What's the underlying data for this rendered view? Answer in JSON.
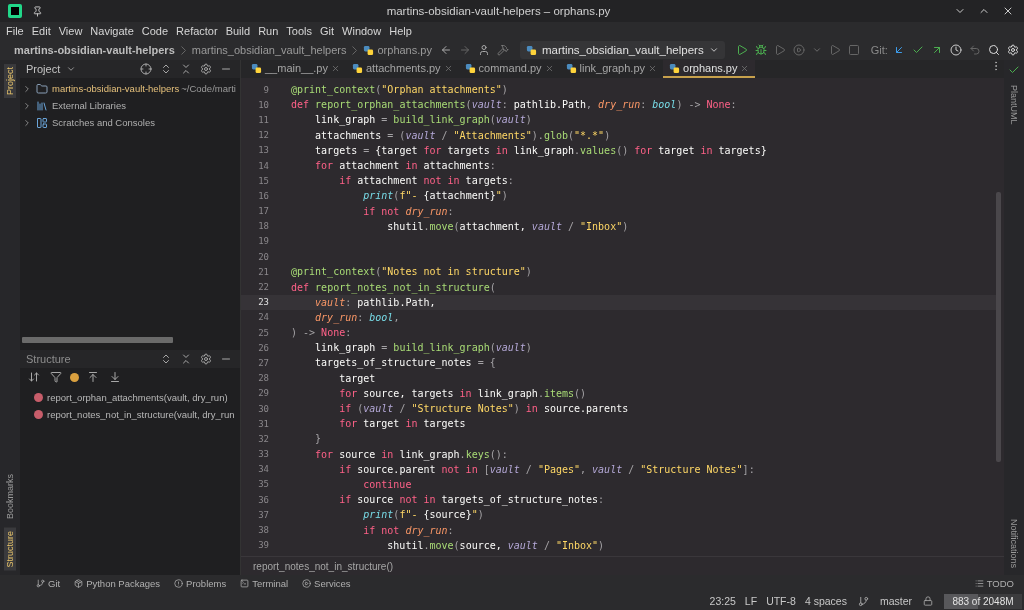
{
  "window": {
    "title": "martins-obsidian-vault-helpers – orphans.py"
  },
  "menu": [
    "File",
    "Edit",
    "View",
    "Navigate",
    "Code",
    "Refactor",
    "Build",
    "Run",
    "Tools",
    "Git",
    "Window",
    "Help"
  ],
  "nav": {
    "breadcrumbs": [
      "martins-obsidian-vault-helpers",
      "martins_obsidian_vault_helpers",
      "orphans.py"
    ],
    "run_config": "martins_obsidian_vault_helpers",
    "git_label": "Git:"
  },
  "left_strip": {
    "top": [
      {
        "label": "Project",
        "selected": true
      }
    ],
    "bottom": [
      {
        "label": "Bookmarks",
        "selected": false
      },
      {
        "label": "Structure",
        "selected": true
      }
    ]
  },
  "project": {
    "title": "Project",
    "items": [
      {
        "kind": "folder",
        "name": "martins-obsidian-vault-helpers",
        "hint": "~/Code/marti",
        "expanded": false
      },
      {
        "kind": "library",
        "name": "External Libraries",
        "expanded": false
      },
      {
        "kind": "scratches",
        "name": "Scratches and Consoles",
        "expanded": false
      }
    ]
  },
  "structure": {
    "title": "Structure",
    "items": [
      "report_orphan_attachments(vault, dry_run)",
      "report_notes_not_in_structure(vault, dry_run"
    ]
  },
  "tabs": [
    {
      "label": "__main__.py",
      "selected": false
    },
    {
      "label": "attachments.py",
      "selected": false
    },
    {
      "label": "command.py",
      "selected": false
    },
    {
      "label": "link_graph.py",
      "selected": false
    },
    {
      "label": "orphans.py",
      "selected": true
    }
  ],
  "code": [
    {
      "n": "9",
      "current": false,
      "t": [
        {
          "kind": "dec",
          "text": "@print_context"
        },
        {
          "kind": "p",
          "text": "("
        },
        {
          "kind": "str",
          "text": "\"Orphan attachments\""
        },
        {
          "kind": "p",
          "text": ")"
        }
      ]
    },
    {
      "n": "10",
      "current": false,
      "t": [
        {
          "kind": "kw",
          "text": "def "
        },
        {
          "kind": "fn",
          "text": "report_orphan_attachments"
        },
        {
          "kind": "p",
          "text": "("
        },
        {
          "kind": "pv",
          "text": "vault"
        },
        {
          "kind": "p",
          "text": ": "
        },
        {
          "kind": "x",
          "text": "pathlib.Path"
        },
        {
          "kind": "p",
          "text": ", "
        },
        {
          "kind": "pa",
          "text": "dry_run"
        },
        {
          "kind": "p",
          "text": ": "
        },
        {
          "kind": "ty",
          "text": "bool"
        },
        {
          "kind": "p",
          "text": ") -> "
        },
        {
          "kind": "kw",
          "text": "None"
        },
        {
          "kind": "p",
          "text": ":"
        }
      ]
    },
    {
      "n": "11",
      "current": false,
      "t": [
        {
          "kind": "x",
          "text": "    link_graph "
        },
        {
          "kind": "p",
          "text": "= "
        },
        {
          "kind": "fn",
          "text": "build_link_graph"
        },
        {
          "kind": "p",
          "text": "("
        },
        {
          "kind": "pv",
          "text": "vault"
        },
        {
          "kind": "p",
          "text": ")"
        }
      ]
    },
    {
      "n": "12",
      "current": false,
      "t": [
        {
          "kind": "x",
          "text": "    attachments "
        },
        {
          "kind": "p",
          "text": "= ("
        },
        {
          "kind": "pv",
          "text": "vault"
        },
        {
          "kind": "p",
          "text": " / "
        },
        {
          "kind": "str",
          "text": "\"Attachments\""
        },
        {
          "kind": "p",
          "text": ")."
        },
        {
          "kind": "fn",
          "text": "glob"
        },
        {
          "kind": "p",
          "text": "("
        },
        {
          "kind": "str",
          "text": "\"*.*\""
        },
        {
          "kind": "p",
          "text": ")"
        }
      ]
    },
    {
      "n": "13",
      "current": false,
      "t": [
        {
          "kind": "x",
          "text": "    targets "
        },
        {
          "kind": "p",
          "text": "= "
        },
        {
          "kind": "x",
          "text": "{target "
        },
        {
          "kind": "kw",
          "text": "for"
        },
        {
          "kind": "x",
          "text": " targets "
        },
        {
          "kind": "kw",
          "text": "in"
        },
        {
          "kind": "x",
          "text": " link_graph"
        },
        {
          "kind": "p",
          "text": "."
        },
        {
          "kind": "fn",
          "text": "values"
        },
        {
          "kind": "p",
          "text": "() "
        },
        {
          "kind": "kw",
          "text": "for"
        },
        {
          "kind": "x",
          "text": " target "
        },
        {
          "kind": "kw",
          "text": "in"
        },
        {
          "kind": "x",
          "text": " targets}"
        }
      ]
    },
    {
      "n": "14",
      "current": false,
      "t": [
        {
          "kind": "kw",
          "text": "    for"
        },
        {
          "kind": "x",
          "text": " attachment "
        },
        {
          "kind": "kw",
          "text": "in"
        },
        {
          "kind": "x",
          "text": " attachments"
        },
        {
          "kind": "p",
          "text": ":"
        }
      ]
    },
    {
      "n": "15",
      "current": false,
      "t": [
        {
          "kind": "kw",
          "text": "        if"
        },
        {
          "kind": "x",
          "text": " attachment "
        },
        {
          "kind": "kw",
          "text": "not in"
        },
        {
          "kind": "x",
          "text": " targets"
        },
        {
          "kind": "p",
          "text": ":"
        }
      ]
    },
    {
      "n": "16",
      "current": false,
      "t": [
        {
          "kind": "bi",
          "text": "            print"
        },
        {
          "kind": "p",
          "text": "("
        },
        {
          "kind": "str",
          "text": "f\"- "
        },
        {
          "kind": "x",
          "text": "{attachment}"
        },
        {
          "kind": "str",
          "text": "\""
        },
        {
          "kind": "p",
          "text": ")"
        }
      ]
    },
    {
      "n": "17",
      "current": false,
      "t": [
        {
          "kind": "kw",
          "text": "            if not "
        },
        {
          "kind": "pa",
          "text": "dry_run"
        },
        {
          "kind": "p",
          "text": ":"
        }
      ]
    },
    {
      "n": "18",
      "current": false,
      "t": [
        {
          "kind": "x",
          "text": "                shutil"
        },
        {
          "kind": "p",
          "text": "."
        },
        {
          "kind": "fn",
          "text": "move"
        },
        {
          "kind": "p",
          "text": "("
        },
        {
          "kind": "x",
          "text": "attachment, "
        },
        {
          "kind": "pv",
          "text": "vault"
        },
        {
          "kind": "p",
          "text": " / "
        },
        {
          "kind": "str",
          "text": "\"Inbox\""
        },
        {
          "kind": "p",
          "text": ")"
        }
      ]
    },
    {
      "n": "19",
      "current": false
    },
    {
      "n": "20",
      "current": false
    },
    {
      "n": "21",
      "current": false,
      "t": [
        {
          "kind": "dec",
          "text": "@print_context"
        },
        {
          "kind": "p",
          "text": "("
        },
        {
          "kind": "str",
          "text": "\"Notes not in structure\""
        },
        {
          "kind": "p",
          "text": ")"
        }
      ]
    },
    {
      "n": "22",
      "current": false,
      "t": [
        {
          "kind": "kw",
          "text": "def "
        },
        {
          "kind": "fn",
          "text": "report_notes_not_in_structure"
        },
        {
          "kind": "p",
          "text": "("
        }
      ]
    },
    {
      "n": "23",
      "current": true,
      "t": [
        {
          "kind": "pa",
          "text": "    vault"
        },
        {
          "kind": "p",
          "text": ": "
        },
        {
          "kind": "x",
          "text": "pathlib.Path,"
        }
      ]
    },
    {
      "n": "24",
      "current": false,
      "t": [
        {
          "kind": "pa",
          "text": "    dry_run"
        },
        {
          "kind": "p",
          "text": ": "
        },
        {
          "kind": "ty",
          "text": "bool"
        },
        {
          "kind": "p",
          "text": ","
        }
      ]
    },
    {
      "n": "25",
      "current": false,
      "t": [
        {
          "kind": "p",
          "text": ") -> "
        },
        {
          "kind": "kw",
          "text": "None"
        },
        {
          "kind": "p",
          "text": ":"
        }
      ]
    },
    {
      "n": "26",
      "current": false,
      "t": [
        {
          "kind": "x",
          "text": "    link_graph "
        },
        {
          "kind": "p",
          "text": "= "
        },
        {
          "kind": "fn",
          "text": "build_link_graph"
        },
        {
          "kind": "p",
          "text": "("
        },
        {
          "kind": "pv",
          "text": "vault"
        },
        {
          "kind": "p",
          "text": ")"
        }
      ]
    },
    {
      "n": "27",
      "current": false,
      "t": [
        {
          "kind": "x",
          "text": "    targets_of_structure_notes "
        },
        {
          "kind": "p",
          "text": "= {"
        }
      ]
    },
    {
      "n": "28",
      "current": false,
      "t": [
        {
          "kind": "x",
          "text": "        target"
        }
      ]
    },
    {
      "n": "29",
      "current": false,
      "t": [
        {
          "kind": "kw",
          "text": "        for"
        },
        {
          "kind": "x",
          "text": " source, targets "
        },
        {
          "kind": "kw",
          "text": "in"
        },
        {
          "kind": "x",
          "text": " link_graph"
        },
        {
          "kind": "p",
          "text": "."
        },
        {
          "kind": "fn",
          "text": "items"
        },
        {
          "kind": "p",
          "text": "()"
        }
      ]
    },
    {
      "n": "30",
      "current": false,
      "t": [
        {
          "kind": "kw",
          "text": "        if"
        },
        {
          "kind": "p",
          "text": " ("
        },
        {
          "kind": "pv",
          "text": "vault"
        },
        {
          "kind": "p",
          "text": " / "
        },
        {
          "kind": "str",
          "text": "\"Structure Notes\""
        },
        {
          "kind": "p",
          "text": ") "
        },
        {
          "kind": "kw",
          "text": "in"
        },
        {
          "kind": "x",
          "text": " source.parents"
        }
      ]
    },
    {
      "n": "31",
      "current": false,
      "t": [
        {
          "kind": "kw",
          "text": "        for"
        },
        {
          "kind": "x",
          "text": " target "
        },
        {
          "kind": "kw",
          "text": "in"
        },
        {
          "kind": "x",
          "text": " targets"
        }
      ]
    },
    {
      "n": "32",
      "current": false,
      "t": [
        {
          "kind": "p",
          "text": "    }"
        }
      ]
    },
    {
      "n": "33",
      "current": false,
      "t": [
        {
          "kind": "kw",
          "text": "    for"
        },
        {
          "kind": "x",
          "text": " source "
        },
        {
          "kind": "kw",
          "text": "in"
        },
        {
          "kind": "x",
          "text": " link_graph"
        },
        {
          "kind": "p",
          "text": "."
        },
        {
          "kind": "fn",
          "text": "keys"
        },
        {
          "kind": "p",
          "text": "():"
        }
      ]
    },
    {
      "n": "34",
      "current": false,
      "t": [
        {
          "kind": "kw",
          "text": "        if"
        },
        {
          "kind": "x",
          "text": " source.parent "
        },
        {
          "kind": "kw",
          "text": "not in"
        },
        {
          "kind": "p",
          "text": " ["
        },
        {
          "kind": "pv",
          "text": "vault"
        },
        {
          "kind": "p",
          "text": " / "
        },
        {
          "kind": "str",
          "text": "\"Pages\""
        },
        {
          "kind": "p",
          "text": ", "
        },
        {
          "kind": "pv",
          "text": "vault"
        },
        {
          "kind": "p",
          "text": " / "
        },
        {
          "kind": "str",
          "text": "\"Structure Notes\""
        },
        {
          "kind": "p",
          "text": "]:"
        }
      ]
    },
    {
      "n": "35",
      "current": false,
      "t": [
        {
          "kind": "kw",
          "text": "            continue"
        }
      ]
    },
    {
      "n": "36",
      "current": false,
      "t": [
        {
          "kind": "kw",
          "text": "        if"
        },
        {
          "kind": "x",
          "text": " source "
        },
        {
          "kind": "kw",
          "text": "not in"
        },
        {
          "kind": "x",
          "text": " targets_of_structure_notes"
        },
        {
          "kind": "p",
          "text": ":"
        }
      ]
    },
    {
      "n": "37",
      "current": false,
      "t": [
        {
          "kind": "bi",
          "text": "            print"
        },
        {
          "kind": "p",
          "text": "("
        },
        {
          "kind": "str",
          "text": "f\"- "
        },
        {
          "kind": "x",
          "text": "{source}"
        },
        {
          "kind": "str",
          "text": "\""
        },
        {
          "kind": "p",
          "text": ")"
        }
      ]
    },
    {
      "n": "38",
      "current": false,
      "t": [
        {
          "kind": "kw",
          "text": "            if not "
        },
        {
          "kind": "pa",
          "text": "dry_run"
        },
        {
          "kind": "p",
          "text": ":"
        }
      ]
    },
    {
      "n": "39",
      "current": false,
      "t": [
        {
          "kind": "x",
          "text": "                shutil"
        },
        {
          "kind": "p",
          "text": "."
        },
        {
          "kind": "fn",
          "text": "move"
        },
        {
          "kind": "p",
          "text": "("
        },
        {
          "kind": "x",
          "text": "source, "
        },
        {
          "kind": "pv",
          "text": "vault"
        },
        {
          "kind": "p",
          "text": " / "
        },
        {
          "kind": "str",
          "text": "\"Inbox\""
        },
        {
          "kind": "p",
          "text": ")"
        }
      ]
    }
  ],
  "footer_breadcrumb": "report_notes_not_in_structure()",
  "right_strip": {
    "top": [
      "PlantUML"
    ],
    "bottom": [
      "Notifications"
    ]
  },
  "tool_windows": [
    {
      "kind": "git",
      "label": "Git"
    },
    {
      "kind": "packages",
      "label": "Python Packages"
    },
    {
      "kind": "problems",
      "label": "Problems"
    },
    {
      "kind": "terminal",
      "label": "Terminal"
    },
    {
      "kind": "services",
      "label": "Services"
    },
    {
      "kind": "todo",
      "label": "TODO"
    }
  ],
  "status": {
    "position": "23:25",
    "line_sep": "LF",
    "encoding": "UTF-8",
    "indent": "4 spaces",
    "branch": "master",
    "memory": {
      "text": "883 of 2048M",
      "level": 0.43
    }
  }
}
